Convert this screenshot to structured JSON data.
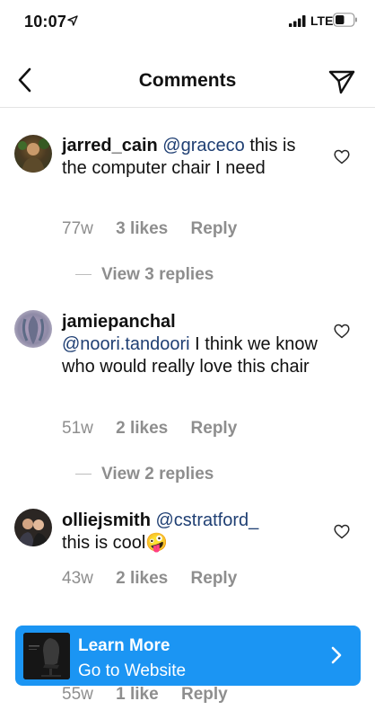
{
  "status_bar": {
    "time": "10:07",
    "network": "LTE"
  },
  "header": {
    "title": "Comments"
  },
  "comments": [
    {
      "username": "jarred_cain",
      "mention": "@graceco",
      "text": "this is the computer chair I need",
      "age": "77w",
      "likes": "3 likes",
      "reply": "Reply",
      "view_replies": "View 3 replies"
    },
    {
      "username": "jamiepanchal",
      "mention": "@noori.tandoori",
      "text": "I think we know who would really love this chair",
      "age": "51w",
      "likes": "2 likes",
      "reply": "Reply",
      "view_replies": "View 2 replies"
    },
    {
      "username": "olliejsmith",
      "mention": "@cstratford_",
      "text": "this is cool",
      "emoji": "🤪",
      "age": "43w",
      "likes": "2 likes",
      "reply": "Reply"
    },
    {
      "age": "55w",
      "likes": "1 like",
      "reply": "Reply"
    }
  ],
  "ad": {
    "title": "Learn More",
    "subtitle": "Go to Website"
  },
  "colors": {
    "accent": "#1b95f3",
    "mention": "#1f3f73",
    "meta": "#8e8e8e"
  }
}
